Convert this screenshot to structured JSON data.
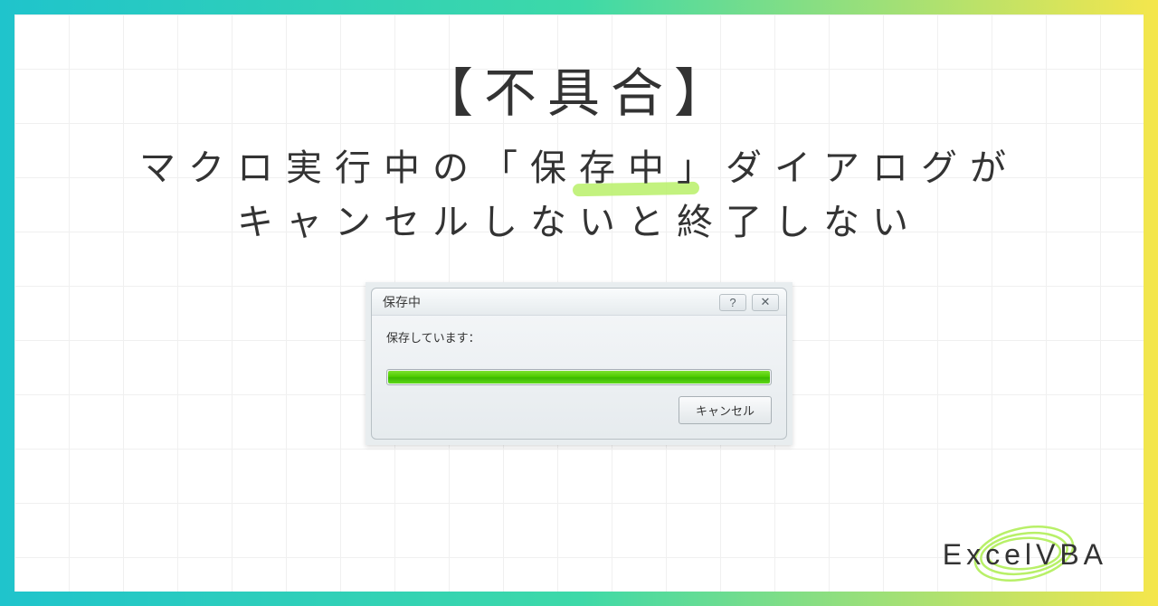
{
  "heading": "【不具合】",
  "subtitle_line1": "マクロ実行中の「保存中」ダイアログが",
  "subtitle_line2": "キャンセルしないと終了しない",
  "dialog": {
    "title": "保存中",
    "help_glyph": "?",
    "close_glyph": "✕",
    "message": "保存しています：",
    "cancel_label": "キャンセル",
    "progress_percent": 100
  },
  "watermark": "ExcelVBA",
  "colors": {
    "gradient_start": "#1fc4cc",
    "gradient_mid": "#3dd9a8",
    "gradient_end": "#f5e64c",
    "highlight": "#b8f068",
    "progress_green": "#4fcc00"
  }
}
